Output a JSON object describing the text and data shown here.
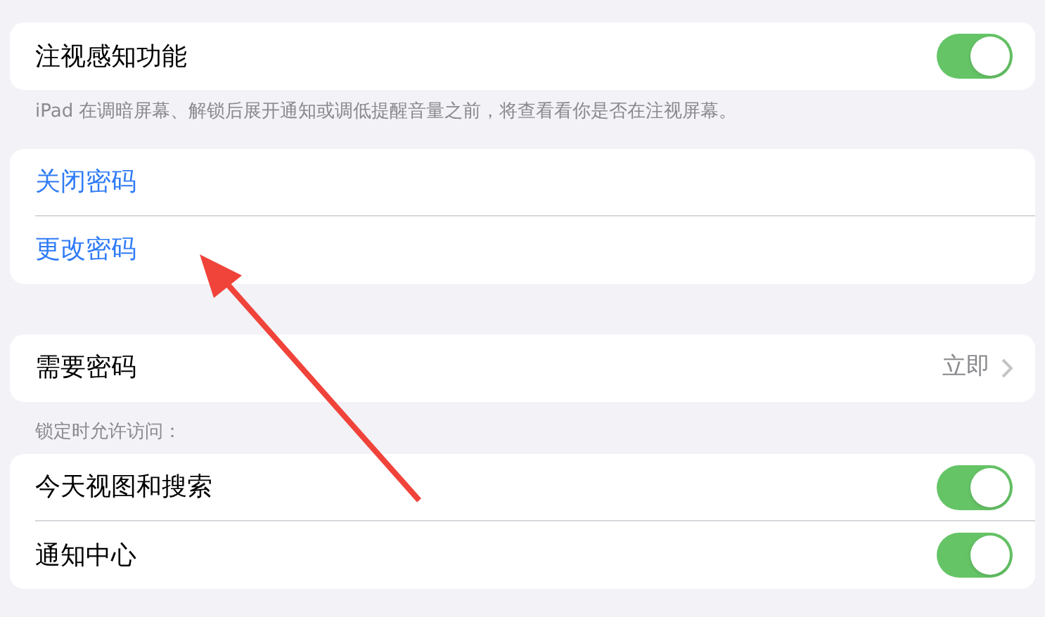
{
  "groups": [
    {
      "rows": [
        {
          "kind": "toggle",
          "label": "注视感知功能",
          "on": true
        }
      ],
      "footer": "iPad 在调暗屏幕、解锁后展开通知或调低提醒音量之前，将查看看你是否在注视屏幕。"
    },
    {
      "rows": [
        {
          "kind": "link",
          "label": "关闭密码"
        },
        {
          "kind": "link",
          "label": "更改密码"
        }
      ]
    },
    {
      "rows": [
        {
          "kind": "value",
          "label": "需要密码",
          "value": "立即"
        }
      ]
    },
    {
      "header": "锁定时允许访问：",
      "rows": [
        {
          "kind": "toggle",
          "label": "今天视图和搜索",
          "on": true
        },
        {
          "kind": "toggle",
          "label": "通知中心",
          "on": true
        }
      ]
    }
  ]
}
